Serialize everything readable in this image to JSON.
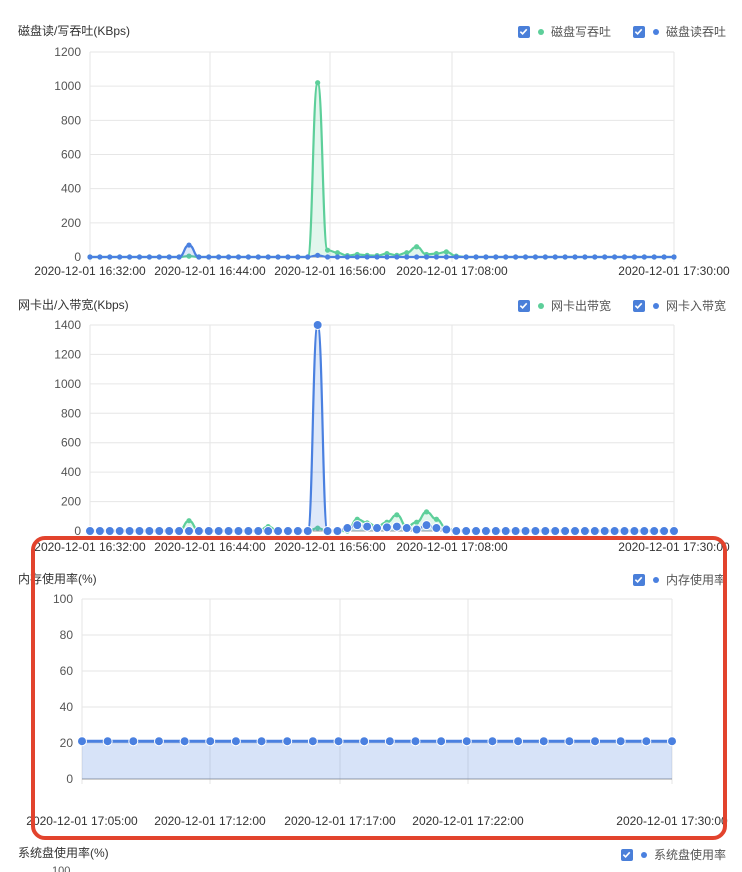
{
  "colors": {
    "green": "#5dcf9a",
    "blue": "#4a80e0",
    "highlight": "#e2432d"
  },
  "panels": [
    {
      "title": "磁盘读/写吞吐(KBps)",
      "legend": [
        {
          "label": "磁盘写吞吐",
          "color": "#5dcf9a",
          "checked": true
        },
        {
          "label": "磁盘读吞吐",
          "color": "#4a80e0",
          "checked": true
        }
      ]
    },
    {
      "title": "网卡出/入带宽(Kbps)",
      "legend": [
        {
          "label": "网卡出带宽",
          "color": "#5dcf9a",
          "checked": true
        },
        {
          "label": "网卡入带宽",
          "color": "#4a80e0",
          "checked": true
        }
      ]
    },
    {
      "title": "内存使用率(%)",
      "legend": [
        {
          "label": "内存使用率",
          "color": "#4a80e0",
          "checked": true
        }
      ]
    },
    {
      "title": "系统盘使用率(%)",
      "legend": [
        {
          "label": "系统盘使用率",
          "color": "#4a80e0",
          "checked": true
        }
      ]
    }
  ],
  "chart_data": [
    {
      "type": "line",
      "title": "磁盘读/写吞吐(KBps)",
      "ylim": [
        0,
        1200
      ],
      "yticks": [
        "0",
        "200",
        "400",
        "600",
        "800",
        "1000",
        "1200"
      ],
      "xticks": [
        "2020-12-01 16:32:00",
        "2020-12-01 16:44:00",
        "2020-12-01 16:56:00",
        "2020-12-01 17:08:00",
        "2020-12-01 17:30:00"
      ],
      "series": [
        {
          "name": "磁盘写吞吐",
          "color": "#5dcf9a",
          "values": [
            0,
            0,
            0,
            0,
            0,
            0,
            0,
            0,
            0,
            0,
            5,
            0,
            0,
            0,
            0,
            0,
            0,
            0,
            0,
            0,
            0,
            0,
            0,
            1020,
            40,
            25,
            8,
            15,
            10,
            8,
            20,
            10,
            25,
            60,
            15,
            20,
            30,
            5,
            0,
            0,
            0,
            0,
            0,
            0,
            0,
            0,
            0,
            0,
            0,
            0,
            0,
            0,
            0,
            0,
            0,
            0,
            0,
            0,
            0,
            0
          ]
        },
        {
          "name": "磁盘读吞吐",
          "color": "#4a80e0",
          "values": [
            0,
            0,
            0,
            0,
            0,
            0,
            0,
            0,
            0,
            0,
            70,
            0,
            0,
            0,
            0,
            0,
            0,
            0,
            0,
            0,
            0,
            0,
            0,
            10,
            0,
            0,
            0,
            0,
            0,
            0,
            0,
            0,
            0,
            0,
            0,
            0,
            0,
            0,
            0,
            0,
            0,
            0,
            0,
            0,
            0,
            0,
            0,
            0,
            0,
            0,
            0,
            0,
            0,
            0,
            0,
            0,
            0,
            0,
            0,
            0
          ]
        }
      ]
    },
    {
      "type": "line",
      "title": "网卡出/入带宽(Kbps)",
      "ylim": [
        0,
        1400
      ],
      "yticks": [
        "0",
        "200",
        "400",
        "600",
        "800",
        "1000",
        "1200",
        "1400"
      ],
      "xticks": [
        "2020-12-01 16:32:00",
        "2020-12-01 16:44:00",
        "2020-12-01 16:56:00",
        "2020-12-01 17:08:00",
        "2020-12-01 17:30:00"
      ],
      "series": [
        {
          "name": "网卡出带宽",
          "color": "#5dcf9a",
          "values": [
            0,
            0,
            0,
            0,
            0,
            0,
            0,
            0,
            0,
            0,
            70,
            0,
            0,
            0,
            0,
            0,
            0,
            0,
            30,
            0,
            0,
            0,
            0,
            20,
            0,
            0,
            0,
            80,
            55,
            30,
            60,
            110,
            30,
            60,
            130,
            80,
            20,
            0,
            0,
            0,
            0,
            0,
            0,
            0,
            0,
            0,
            0,
            0,
            0,
            0,
            0,
            0,
            0,
            0,
            0,
            0,
            0,
            0,
            0,
            0
          ]
        },
        {
          "name": "网卡入带宽",
          "color": "#4a80e0",
          "values": [
            0,
            0,
            0,
            0,
            0,
            0,
            0,
            0,
            0,
            0,
            0,
            0,
            0,
            0,
            0,
            0,
            0,
            0,
            0,
            0,
            0,
            0,
            0,
            1400,
            0,
            0,
            20,
            40,
            30,
            20,
            25,
            30,
            20,
            10,
            40,
            20,
            10,
            0,
            0,
            0,
            0,
            0,
            0,
            0,
            0,
            0,
            0,
            0,
            0,
            0,
            0,
            0,
            0,
            0,
            0,
            0,
            0,
            0,
            0,
            0
          ]
        }
      ]
    },
    {
      "type": "area",
      "title": "内存使用率(%)",
      "ylim": [
        0,
        100
      ],
      "yticks": [
        "0",
        "20",
        "40",
        "60",
        "80",
        "100"
      ],
      "xticks": [
        "2020-12-01 17:05:00",
        "2020-12-01 17:12:00",
        "2020-12-01 17:17:00",
        "2020-12-01 17:22:00",
        "2020-12-01 17:30:00"
      ],
      "series": [
        {
          "name": "内存使用率",
          "color": "#4a80e0",
          "values": [
            21,
            21,
            21,
            21,
            21,
            21,
            21,
            21,
            21,
            21,
            21,
            21,
            21,
            21,
            21,
            21,
            21,
            21,
            21,
            21,
            21,
            21,
            21,
            21
          ]
        }
      ]
    }
  ],
  "partial_chart": {
    "title": "系统盘使用率(%)",
    "ytick": "100"
  }
}
